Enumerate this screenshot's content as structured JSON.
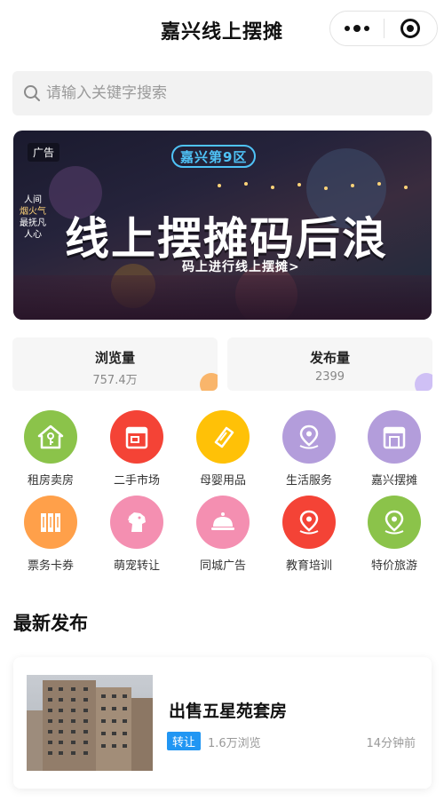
{
  "header": {
    "title": "嘉兴线上摆摊"
  },
  "search": {
    "placeholder": "请输入关键字搜索"
  },
  "banner": {
    "ad_label": "广告",
    "brand": "嘉兴第9区",
    "side_text": [
      "人间",
      "烟火气",
      "最抚凡人心"
    ],
    "headline": "线上摆摊码后浪",
    "subline": "码上进行线上摆摊>"
  },
  "stats": [
    {
      "label": "浏览量",
      "value": "757.4万",
      "accent": "#f9b56b"
    },
    {
      "label": "发布量",
      "value": "2399",
      "accent": "#cfc0f5"
    }
  ],
  "categories": [
    {
      "label": "租房卖房",
      "icon": "house-icon",
      "color": "#8bc34a"
    },
    {
      "label": "二手市场",
      "icon": "shop-icon",
      "color": "#f44336"
    },
    {
      "label": "母婴用品",
      "icon": "tag-icon",
      "color": "#ffc107"
    },
    {
      "label": "生活服务",
      "icon": "location-pin-icon",
      "color": "#b39ddb"
    },
    {
      "label": "嘉兴摆摊",
      "icon": "stall-icon",
      "color": "#b39ddb"
    },
    {
      "label": "票务卡券",
      "icon": "tickets-icon",
      "color": "#ffa04a"
    },
    {
      "label": "萌宠转让",
      "icon": "dog-icon",
      "color": "#f48fb1"
    },
    {
      "label": "同城广告",
      "icon": "bell-icon",
      "color": "#f48fb1"
    },
    {
      "label": "教育培训",
      "icon": "location-pin-icon",
      "color": "#f44336"
    },
    {
      "label": "特价旅游",
      "icon": "location-pin-icon",
      "color": "#8bc34a"
    }
  ],
  "latest": {
    "section_title": "最新发布",
    "items": [
      {
        "title": "出售五星苑套房",
        "tag": "转让",
        "views": "1.6万浏览",
        "time": "14分钟前"
      }
    ]
  }
}
